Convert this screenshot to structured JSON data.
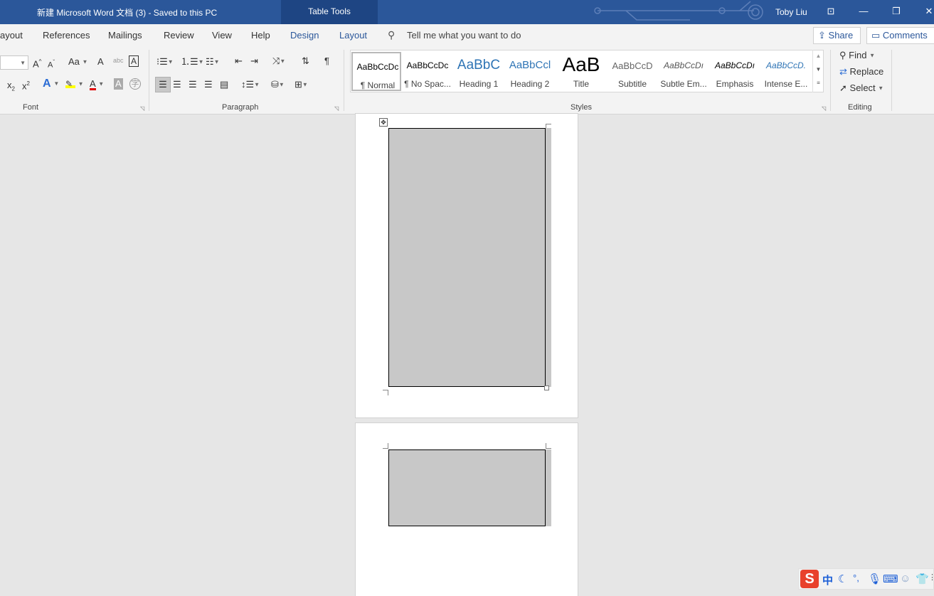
{
  "titlebar": {
    "doc_title": "新建 Microsoft Word 文档 (3)  -  Saved to this PC",
    "context_tab": "Table Tools",
    "user": "Toby Liu",
    "ribbon_display_icon": "ribbon-display-icon",
    "minimize_icon": "minimize-icon",
    "restore_icon": "restore-icon",
    "close_icon": "close-icon"
  },
  "tabs": {
    "layout_partial": "ayout",
    "references": "References",
    "mailings": "Mailings",
    "review": "Review",
    "view": "View",
    "help": "Help",
    "design": "Design",
    "layout": "Layout",
    "tell_me": "Tell me what you want to do",
    "share": "Share",
    "comments": "Comments"
  },
  "ribbon": {
    "font_group": "Font",
    "paragraph_group": "Paragraph",
    "styles_group": "Styles",
    "editing_group": "Editing",
    "font": {
      "grow": "A",
      "shrink": "A",
      "change_case": "Aa",
      "clear_format": "A",
      "phonetic": "abc",
      "char_border": "A",
      "subscript": "x",
      "superscript": "x",
      "text_effects": "A",
      "font_color": "A",
      "char_shading": "A",
      "enclose": "字"
    },
    "styles": [
      {
        "preview": "AaBbCcDc",
        "name": "¶ Normal"
      },
      {
        "preview": "AaBbCcDc",
        "name": "¶ No Spac..."
      },
      {
        "preview": "AaBbC",
        "name": "Heading 1"
      },
      {
        "preview": "AaBbCcl",
        "name": "Heading 2"
      },
      {
        "preview": "AaB",
        "name": "Title"
      },
      {
        "preview": "AaBbCcD",
        "name": "Subtitle"
      },
      {
        "preview": "AaBbCcDı",
        "name": "Subtle Em..."
      },
      {
        "preview": "AaBbCcDı",
        "name": "Emphasis"
      },
      {
        "preview": "AaBbCcD.",
        "name": "Intense E..."
      }
    ],
    "editing": {
      "find": "Find",
      "replace": "Replace",
      "select": "Select"
    }
  },
  "ime": {
    "lang": "中"
  },
  "colors": {
    "titlebar": "#2b579a",
    "context_tab": "#1e4583",
    "accent": "#2b579a",
    "highlight": "#ffff00",
    "font_color": "#e00000",
    "cell_fill": "#c8c8c8"
  }
}
